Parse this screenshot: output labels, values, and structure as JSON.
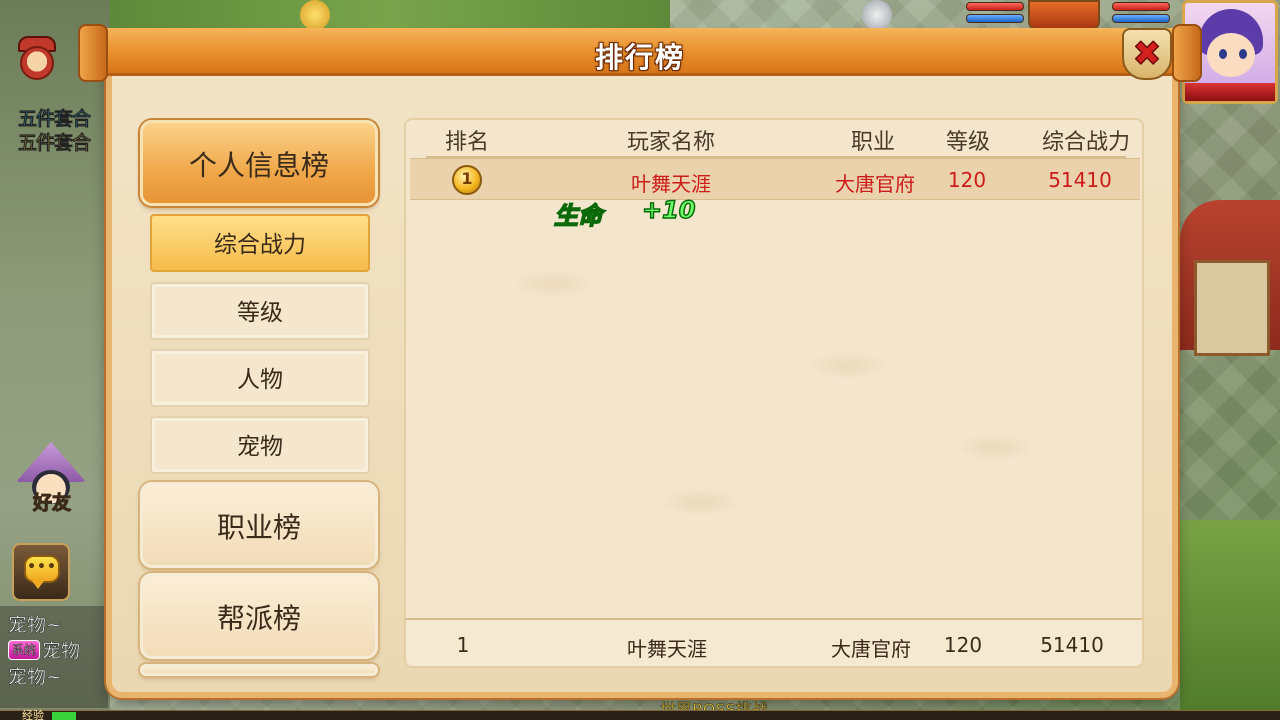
{
  "dialog": {
    "title": "排行榜",
    "close_icon": "close-x-icon"
  },
  "tabs": {
    "personal": "个人信息榜",
    "sub": [
      "综合战力",
      "等级",
      "人物",
      "宠物"
    ],
    "profession": "职业榜",
    "guild": "帮派榜"
  },
  "table": {
    "headers": [
      "排名",
      "玩家名称",
      "职业",
      "等级",
      "综合战力"
    ],
    "rows": [
      {
        "rank": "1",
        "name": "叶舞天涯",
        "profession": "大唐官府",
        "level": "120",
        "power": "51410"
      }
    ],
    "self": {
      "rank": "1",
      "name": "叶舞天涯",
      "profession": "大唐官府",
      "level": "120",
      "power": "51410"
    }
  },
  "floating_text": {
    "label": "生命",
    "value": "+10"
  },
  "hud": {
    "promo_line_1": "五件套合",
    "promo_line_2": "五件套合",
    "friend_label": "好友",
    "chat_lines": [
      {
        "tag": "",
        "text": "宠物~"
      },
      {
        "tag": "系统",
        "text": "宠物"
      },
      {
        "tag": "",
        "text": "宠物~"
      }
    ],
    "xp_label": "经验",
    "bottom_text": "世界BOSS挑战"
  },
  "colors": {
    "header_orange": "#e98f2b",
    "highlight_red": "#cc1b1b",
    "panel_bg": "#f3e6cc",
    "float_green": "#6dff6a"
  }
}
